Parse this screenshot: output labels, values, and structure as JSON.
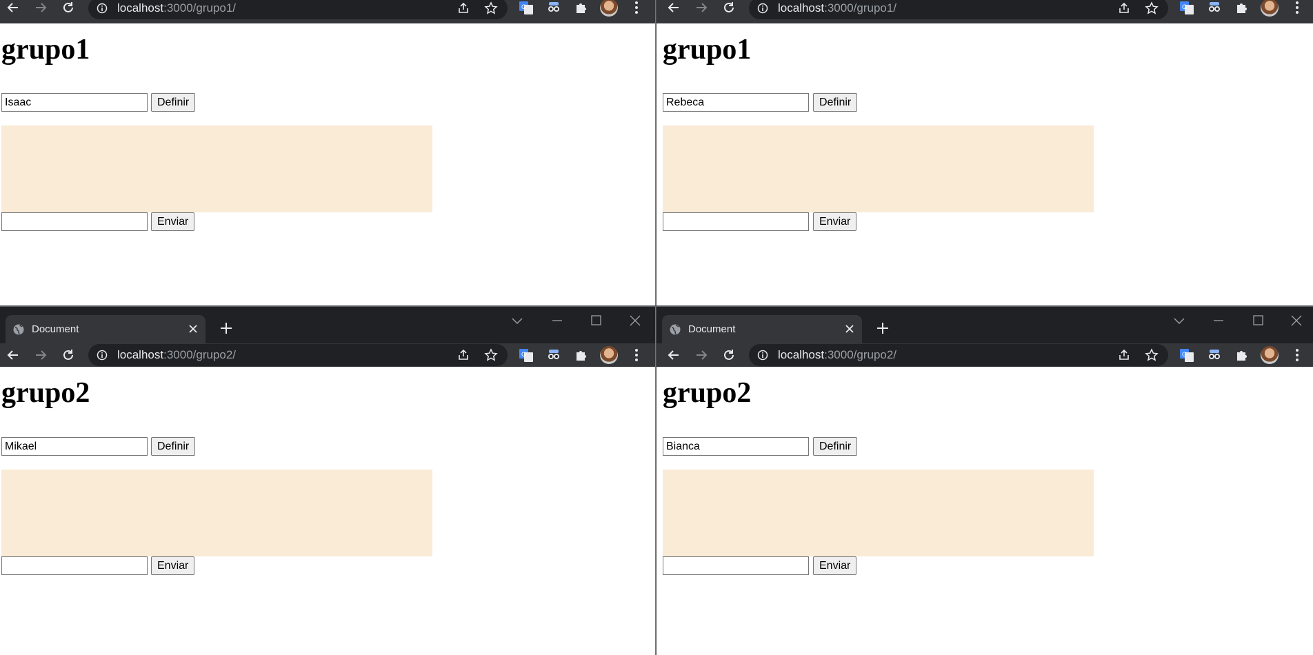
{
  "windows": [
    {
      "id": "tl",
      "url": {
        "host": "localhost",
        "rest": ":3000/grupo1/"
      },
      "heading": "grupo1",
      "name_value": "Isaac",
      "define_label": "Definir",
      "message_value": "",
      "send_label": "Enviar"
    },
    {
      "id": "tr",
      "url": {
        "host": "localhost",
        "rest": ":3000/grupo1/"
      },
      "heading": "grupo1",
      "name_value": "Rebeca",
      "define_label": "Definir",
      "message_value": "",
      "send_label": "Enviar"
    },
    {
      "id": "bl",
      "tab_title": "Document",
      "url": {
        "host": "localhost",
        "rest": ":3000/grupo2/"
      },
      "heading": "grupo2",
      "name_value": "Mikael",
      "define_label": "Definir",
      "message_value": "",
      "send_label": "Enviar"
    },
    {
      "id": "br",
      "tab_title": "Document",
      "url": {
        "host": "localhost",
        "rest": ":3000/grupo2/"
      },
      "heading": "grupo2",
      "name_value": "Bianca",
      "define_label": "Definir",
      "message_value": "",
      "send_label": "Enviar"
    }
  ],
  "colors": {
    "message_area": "#faebd7",
    "chrome_dark": "#202124",
    "chrome_toolbar": "#35363a"
  },
  "icons": {
    "toolbar": [
      "back-icon",
      "forward-icon",
      "reload-icon",
      "info-icon",
      "share-icon",
      "star-icon",
      "translate-icon",
      "spy-extension-icon",
      "puzzle-icon",
      "profile-avatar",
      "menu-icon"
    ],
    "tabstrip": [
      "globe-icon",
      "close-icon",
      "plus-icon",
      "chevron-down-icon",
      "minimize-icon",
      "maximize-icon",
      "window-close-icon"
    ]
  }
}
